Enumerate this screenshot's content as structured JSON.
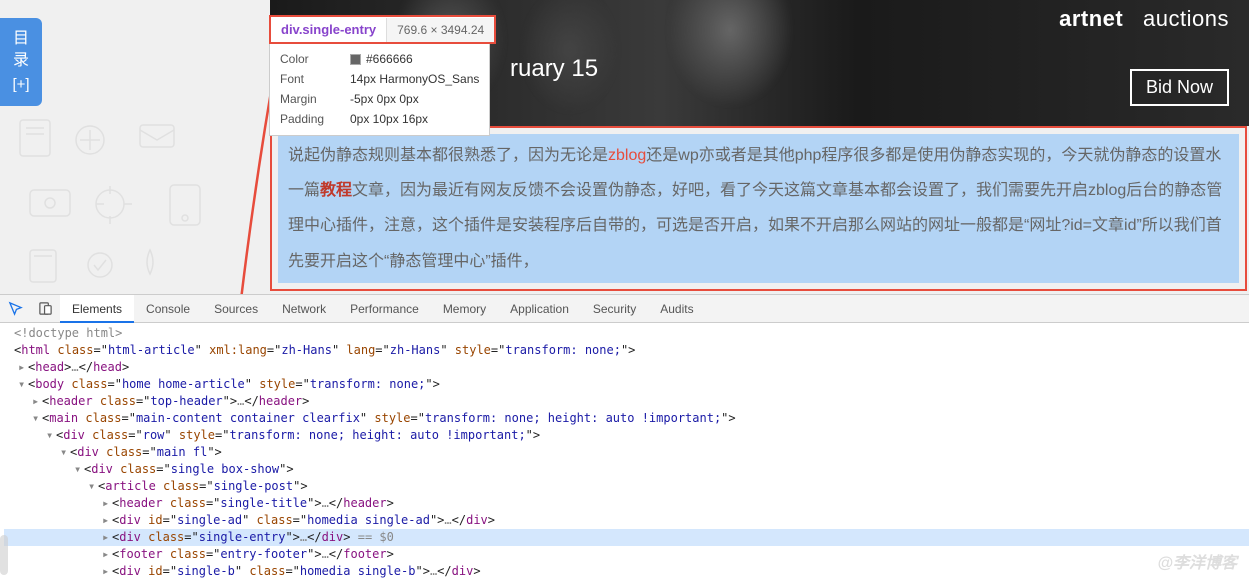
{
  "sidebar": {
    "label_line1": "目",
    "label_line2": "录",
    "plus": "[+]"
  },
  "hero": {
    "brand_left": "artnet",
    "brand_right": "auctions",
    "date": "ruary 15",
    "button": "Bid Now"
  },
  "tooltip": {
    "selector": "div.single-entry",
    "dimensions": "769.6 × 3494.24",
    "rows": [
      {
        "k": "Color",
        "v": "#666666",
        "swatch": true
      },
      {
        "k": "Font",
        "v": "14px HarmonyOS_Sans"
      },
      {
        "k": "Margin",
        "v": "-5px 0px 0px"
      },
      {
        "k": "Padding",
        "v": "0px 10px 16px"
      }
    ]
  },
  "highlight": {
    "pre1": "说起伪静态规则基本都很熟悉了，因为无论是",
    "link1": "zblog",
    "mid1": "还是wp亦或者是其他php程序很多都是使用伪静态实现的，今天就伪静态的设置水一篇",
    "link2": "教程",
    "post": "文章，因为最近有网友反馈不会设置伪静态，好吧，看了今天这篇文章基本都会设置了，我们需要先开启zblog后台的静态管理中心插件，注意，这个插件是安装程序后自带的，可选是否开启，如果不开启那么网站的网址一般都是“网址?id=文章id”所以我们首先要开启这个“静态管理中心”插件，"
  },
  "devtools": {
    "tabs": [
      "Elements",
      "Console",
      "Sources",
      "Network",
      "Performance",
      "Memory",
      "Application",
      "Security",
      "Audits"
    ],
    "active_tab": 0,
    "lines": [
      {
        "indent": 1,
        "tw": "",
        "html": "<span class='gray'>&lt;!doctype html&gt;</span>"
      },
      {
        "indent": 1,
        "tw": "",
        "html": "&lt;<span class='tag'>html</span> <span class='attr'>class</span>=\"<span class='val'>html-article</span>\" <span class='attr'>xml:lang</span>=\"<span class='val'>zh-Hans</span>\" <span class='attr'>lang</span>=\"<span class='val'>zh-Hans</span>\" <span class='attr'>style</span>=\"<span class='val'>transform: none;</span>\"&gt;"
      },
      {
        "indent": 2,
        "tw": "▸",
        "html": "&lt;<span class='tag'>head</span>&gt;<span class='gray'>…</span>&lt;/<span class='tag'>head</span>&gt;"
      },
      {
        "indent": 2,
        "tw": "▾",
        "html": "&lt;<span class='tag'>body</span> <span class='attr'>class</span>=\"<span class='val'>home home-article</span>\" <span class='attr'>style</span>=\"<span class='val'>transform: none;</span>\"&gt;"
      },
      {
        "indent": 3,
        "tw": "▸",
        "html": "&lt;<span class='tag'>header</span> <span class='attr'>class</span>=\"<span class='val'>top-header</span>\"&gt;<span class='gray'>…</span>&lt;/<span class='tag'>header</span>&gt;"
      },
      {
        "indent": 3,
        "tw": "▾",
        "html": "&lt;<span class='tag'>main</span> <span class='attr'>class</span>=\"<span class='val'>main-content container clearfix</span>\" <span class='attr'>style</span>=\"<span class='val'>transform: none; height: auto !important;</span>\"&gt;"
      },
      {
        "indent": 4,
        "tw": "▾",
        "html": "&lt;<span class='tag'>div</span> <span class='attr'>class</span>=\"<span class='val'>row</span>\" <span class='attr'>style</span>=\"<span class='val'>transform: none; height: auto !important;</span>\"&gt;"
      },
      {
        "indent": 5,
        "tw": "▾",
        "html": "&lt;<span class='tag'>div</span> <span class='attr'>class</span>=\"<span class='val'>main fl</span>\"&gt;"
      },
      {
        "indent": 6,
        "tw": "▾",
        "html": "&lt;<span class='tag'>div</span> <span class='attr'>class</span>=\"<span class='val'>single box-show</span>\"&gt;"
      },
      {
        "indent": 7,
        "tw": "▾",
        "html": "&lt;<span class='tag'>article</span> <span class='attr'>class</span>=\"<span class='val'>single-post</span>\"&gt;"
      },
      {
        "indent": 8,
        "tw": "▸",
        "html": "&lt;<span class='tag'>header</span> <span class='attr'>class</span>=\"<span class='val'>single-title</span>\"&gt;<span class='gray'>…</span>&lt;/<span class='tag'>header</span>&gt;"
      },
      {
        "indent": 8,
        "tw": "▸",
        "html": "&lt;<span class='tag'>div</span> <span class='attr'>id</span>=\"<span class='val'>single-ad</span>\" <span class='attr'>class</span>=\"<span class='val'>homedia single-ad</span>\"&gt;<span class='gray'>…</span>&lt;/<span class='tag'>div</span>&gt;"
      },
      {
        "indent": 8,
        "tw": "▸",
        "html": "&lt;<span class='tag'>div</span> <span class='attr'>class</span>=\"<span class='val'>single-entry</span>\"&gt;<span class='gray'>…</span>&lt;/<span class='tag'>div</span>&gt; <span class='eq0'>== $0</span>",
        "selected": true
      },
      {
        "indent": 8,
        "tw": "▸",
        "html": "&lt;<span class='tag'>footer</span> <span class='attr'>class</span>=\"<span class='val'>entry-footer</span>\"&gt;<span class='gray'>…</span>&lt;/<span class='tag'>footer</span>&gt;"
      },
      {
        "indent": 8,
        "tw": "▸",
        "html": "&lt;<span class='tag'>div</span> <span class='attr'>id</span>=\"<span class='val'>single-b</span>\" <span class='attr'>class</span>=\"<span class='val'>homedia single-b</span>\"&gt;<span class='gray'>…</span>&lt;/<span class='tag'>div</span>&gt;"
      }
    ]
  },
  "watermark": "@李洋博客"
}
